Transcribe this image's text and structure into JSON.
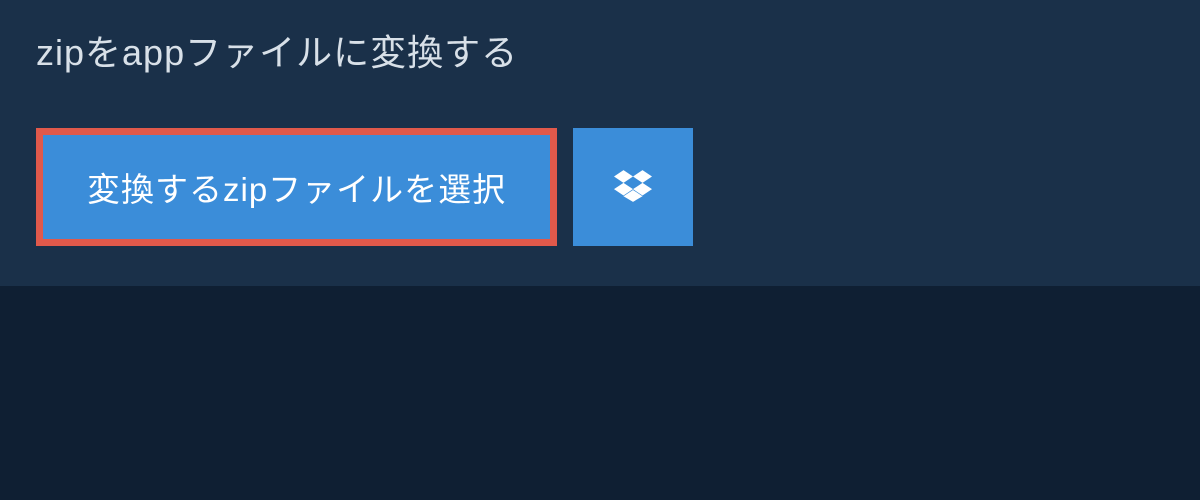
{
  "heading": "zipをappファイルに変換する",
  "select_button_label": "変換するzipファイルを選択",
  "dropbox_icon_name": "dropbox-icon",
  "colors": {
    "page_bg": "#0f1f33",
    "panel_bg": "#1a3049",
    "button_bg": "#3b8dd9",
    "highlight_border": "#e0594b",
    "text_light": "#d8e0e8",
    "text_white": "#ffffff"
  }
}
